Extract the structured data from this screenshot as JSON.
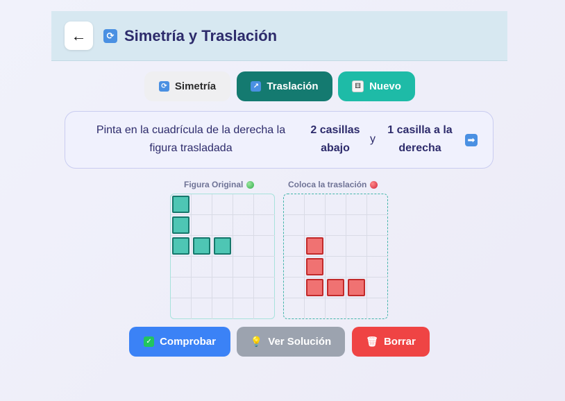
{
  "header": {
    "back_label": "←",
    "title_icon": "repeat-icon",
    "title": "Simetría y Traslación"
  },
  "tabs": [
    {
      "icon": "repeat-icon",
      "label": "Simetría",
      "active": false
    },
    {
      "icon": "arrow-up-right-icon",
      "label": "Traslación",
      "active": true
    },
    {
      "icon": "die-icon",
      "label": "Nuevo",
      "active": false
    }
  ],
  "instruction": {
    "text": "Pinta en la cuadrícula de la derecha la figura trasladada",
    "highlight_1": "2 casillas abajo",
    "connector": "y",
    "highlight_2": "1 casilla a la derecha",
    "arrow_icon": "arrow-right-icon"
  },
  "grids": {
    "original": {
      "label": "Figura Original",
      "status_icon": "green-circle-icon",
      "cols": 5,
      "rows": 6,
      "filled_cells": [
        [
          0,
          0
        ],
        [
          1,
          0
        ],
        [
          2,
          0
        ],
        [
          2,
          1
        ],
        [
          2,
          2
        ]
      ]
    },
    "translated": {
      "label": "Coloca la traslación",
      "status_icon": "red-circle-icon",
      "cols": 5,
      "rows": 6,
      "filled_cells": [
        [
          2,
          1
        ],
        [
          3,
          1
        ],
        [
          4,
          1
        ],
        [
          4,
          2
        ],
        [
          4,
          3
        ]
      ]
    }
  },
  "actions": {
    "check": {
      "icon": "check-icon",
      "label": "Comprobar"
    },
    "solution": {
      "icon": "lightbulb-icon",
      "label": "Ver Solución"
    },
    "clear": {
      "icon": "trash-icon",
      "label": "Borrar"
    }
  },
  "colors": {
    "header_bg": "#d7e8f1",
    "title_text": "#2d2b6b",
    "tab_active": "#147a70",
    "tab_new": "#1ebba7",
    "teal_fill": "#4ec6b4",
    "red_fill": "#f07272",
    "btn_check": "#3b82f6",
    "btn_solution": "#9ca3af",
    "btn_clear": "#ef4444"
  }
}
